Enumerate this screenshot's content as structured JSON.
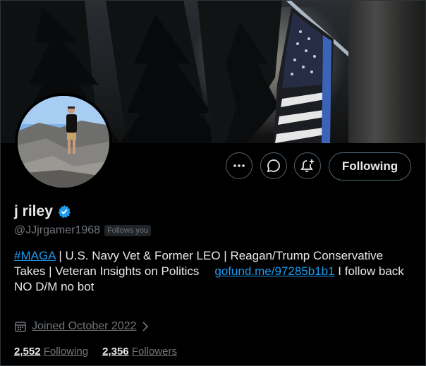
{
  "profile": {
    "display_name": "j riley",
    "handle": "@JJjrgamer1968",
    "follows_you_badge": "Follows you",
    "verified_icon": "verified-badge-icon"
  },
  "actions": {
    "more_icon": "more-icon",
    "message_icon": "message-icon",
    "notify_icon": "bell-plus-icon",
    "follow_label": "Following"
  },
  "bio": {
    "hashtag": "#MAGA",
    "text_part1": " | U.S. Navy Vet & Former LEO | Reagan/Trump Conservative Takes | Veteran Insights on Politics",
    "link": "gofund.me/97285b1b1",
    "text_part2": " I follow back",
    "line2": "NO D/M no bot"
  },
  "meta": {
    "calendar_icon": "calendar-icon",
    "joined": "Joined October 2022"
  },
  "stats": {
    "following_count": "2,552",
    "following_label": "Following",
    "followers_count": "2,356",
    "followers_label": "Followers"
  },
  "colors": {
    "background": "#000000",
    "text": "#e7e9ea",
    "secondary": "#71767b",
    "link": "#1d9bf0",
    "border": "#536471",
    "verified": "#1d9bf0"
  }
}
